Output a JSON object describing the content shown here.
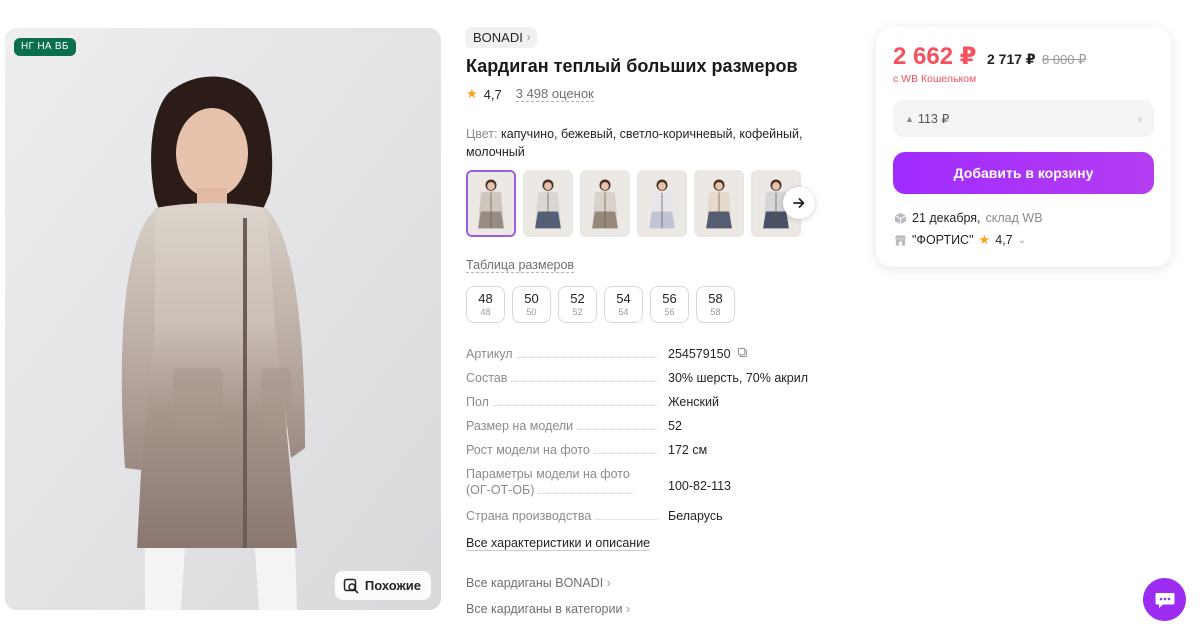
{
  "product": {
    "badge": "НГ НА ВБ",
    "similar_label": "Похожие",
    "brand": "BONADI",
    "title": "Кардиган теплый больших размеров",
    "rating": "4,7",
    "reviews": "3 498 оценок",
    "color_label": "Цвет:",
    "color_values": "капучино, бежевый, светло-коричневый, кофейный, молочный",
    "thumbnails": [
      {
        "name": "variant-1",
        "colors": [
          "#cfc6bd",
          "#8d817a"
        ]
      },
      {
        "name": "variant-2",
        "colors": [
          "#d9d6d3",
          "#3a4a66"
        ]
      },
      {
        "name": "variant-3",
        "colors": [
          "#d8d2ca",
          "#8c7c6b"
        ]
      },
      {
        "name": "variant-4",
        "colors": [
          "#e8e6ea",
          "#b8bdd0"
        ]
      },
      {
        "name": "variant-5",
        "colors": [
          "#e4d9cc",
          "#3b4660"
        ]
      },
      {
        "name": "variant-6",
        "colors": [
          "#d5d5d8",
          "#2f3a52"
        ]
      }
    ],
    "size_table_label": "Таблица размеров",
    "sizes": [
      {
        "main": "48",
        "sub": "48"
      },
      {
        "main": "50",
        "sub": "50"
      },
      {
        "main": "52",
        "sub": "52"
      },
      {
        "main": "54",
        "sub": "54"
      },
      {
        "main": "56",
        "sub": "56"
      },
      {
        "main": "58",
        "sub": "58"
      }
    ],
    "specs": [
      {
        "key": "Артикул",
        "value": "254579150"
      },
      {
        "key": "Состав",
        "value": "30% шерсть, 70% акрил"
      },
      {
        "key": "Пол",
        "value": "Женский"
      },
      {
        "key": "Размер на модели",
        "value": "52"
      },
      {
        "key": "Рост модели на фото",
        "value": "172 см"
      },
      {
        "key": "Параметры модели на фото (ОГ-ОТ-ОБ)",
        "value": "100-82-113"
      },
      {
        "key": "Страна производства",
        "value": "Беларусь"
      }
    ],
    "all_characteristics": "Все характеристики и описание",
    "link_brand": "Все кардиганы BONADI",
    "link_category": "Все кардиганы в категории"
  },
  "buy": {
    "price": "2 662 ₽",
    "price_no_wallet": "2 717 ₽",
    "price_old": "8 000 ₽",
    "wallet_note": "с WB Кошельком",
    "cashback": "113 ₽",
    "add_to_cart": "Добавить в корзину",
    "delivery_date": "21 декабря,",
    "delivery_place": "склад WB",
    "seller": "\"ФОРТИС\"",
    "seller_rating": "4,7"
  },
  "colors": {
    "accent": "#a02bff",
    "price": "#f5515f",
    "badge": "#0b6e4f",
    "star": "#ff9f1c"
  },
  "icons": {
    "similar": "search-image-icon",
    "copy": "copy-icon",
    "next": "arrow-right-icon",
    "box": "box-icon",
    "shop": "shop-icon",
    "chat": "chat-icon"
  }
}
